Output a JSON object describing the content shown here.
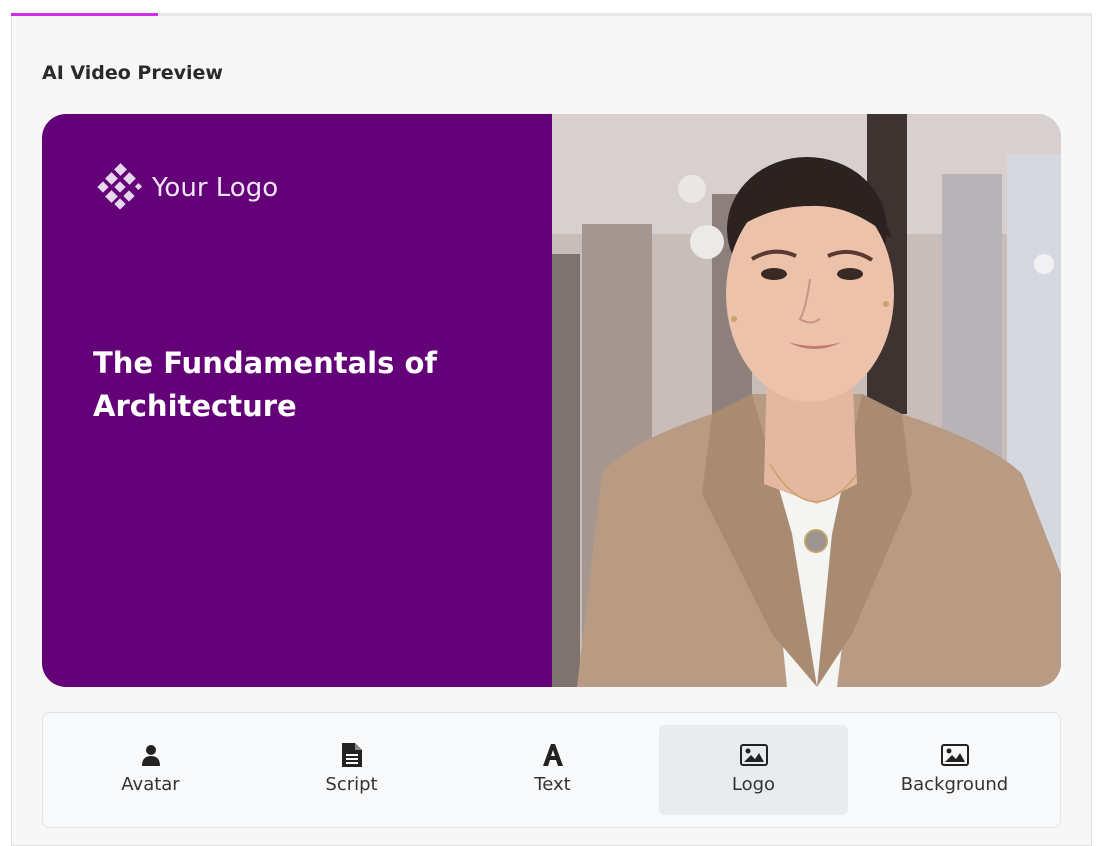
{
  "progress": {
    "fraction": 0.136,
    "color": "#d02ee6"
  },
  "panel": {
    "title": "AI Video Preview"
  },
  "preview": {
    "logo_text": "Your Logo",
    "headline": "The Fundamentals of Architecture",
    "background_color": "#640078",
    "presenter": "avatar-presenter"
  },
  "toolbar": {
    "items": [
      {
        "label": "Avatar",
        "icon": "user-icon",
        "active": false
      },
      {
        "label": "Script",
        "icon": "document-icon",
        "active": false
      },
      {
        "label": "Text",
        "icon": "text-icon",
        "active": false
      },
      {
        "label": "Logo",
        "icon": "image-icon",
        "active": true
      },
      {
        "label": "Background",
        "icon": "image-icon",
        "active": false
      }
    ]
  }
}
